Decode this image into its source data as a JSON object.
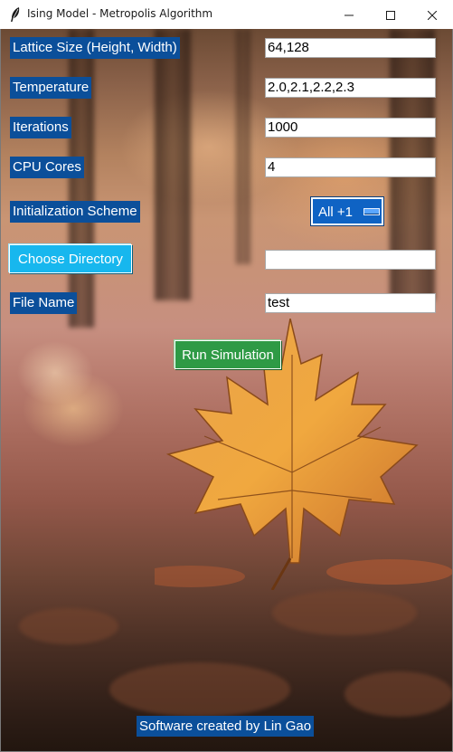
{
  "window": {
    "title": "Ising Model - Metropolis Algorithm"
  },
  "form": {
    "lattice_size": {
      "label": "Lattice Size (Height, Width)",
      "value": "64,128"
    },
    "temperature": {
      "label": "Temperature",
      "value": "2.0,2.1,2.2,2.3"
    },
    "iterations": {
      "label": "Iterations",
      "value": "1000"
    },
    "cpu_cores": {
      "label": "CPU Cores",
      "value": "4"
    },
    "initialization": {
      "label": "Initialization Scheme",
      "selected": "All +1"
    },
    "directory": {
      "button_label": "Choose Directory",
      "value": ""
    },
    "file_name": {
      "label": "File Name",
      "value": "test"
    },
    "run_button_label": "Run Simulation"
  },
  "footer": {
    "credit": "Software created by Lin Gao"
  },
  "colors": {
    "label_bg": "#0b4f9a",
    "dir_button_bg": "#17b7ee",
    "run_button_bg": "#2e9a45",
    "option_menu_bg": "#0f63c4"
  },
  "icons": {
    "app": "feather-icon",
    "minimize": "minimize-icon",
    "maximize": "maximize-icon",
    "close": "close-icon",
    "option_indicator": "option-menu-indicator-icon"
  }
}
